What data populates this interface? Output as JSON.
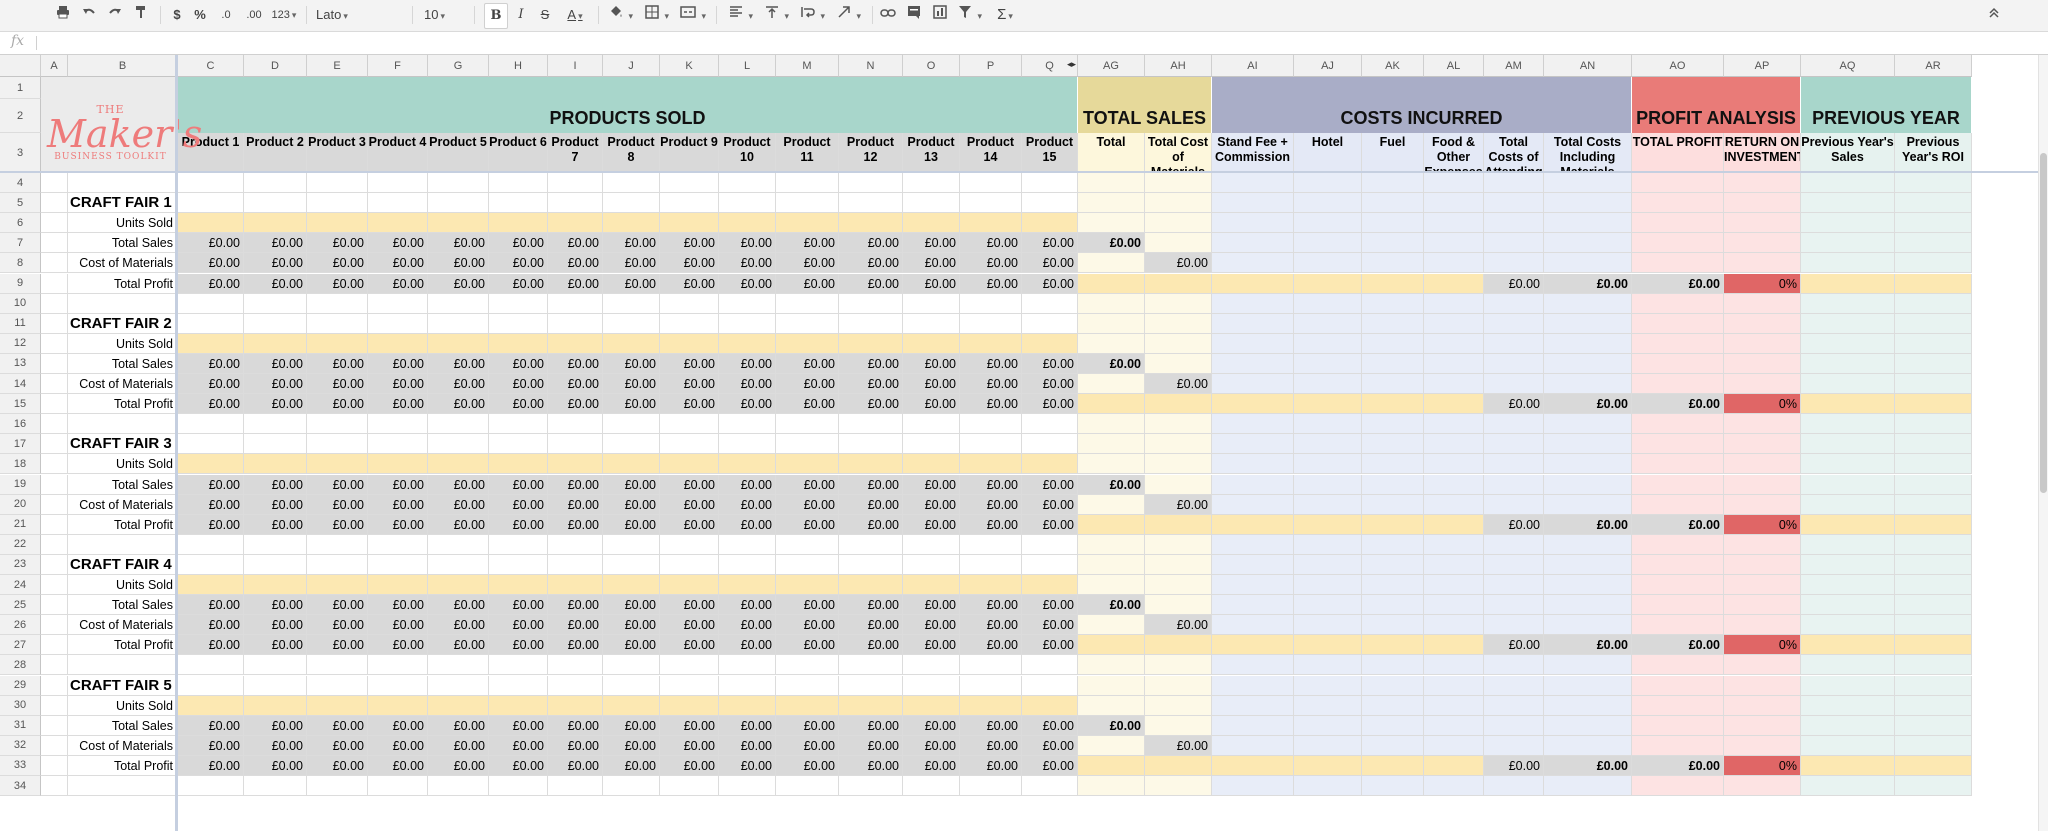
{
  "toolbar": {
    "currency": "$",
    "percent": "%",
    "dec_less": ".0",
    "dec_more": ".00",
    "format_more": "123",
    "font": "Lato",
    "font_size": "10",
    "bold": "B",
    "italic": "I",
    "strike": "S",
    "text_color": "A",
    "sum": "Σ"
  },
  "formula_bar": {
    "icon": "fx",
    "value": ""
  },
  "columns": [
    "A",
    "B",
    "C",
    "D",
    "E",
    "F",
    "G",
    "H",
    "I",
    "J",
    "K",
    "L",
    "M",
    "N",
    "O",
    "P",
    "Q",
    "AG",
    "AH",
    "AI",
    "AJ",
    "AK",
    "AL",
    "AM",
    "AN",
    "AO",
    "AP",
    "AQ",
    "AR"
  ],
  "rows": [
    "1",
    "2",
    "3",
    "4",
    "5",
    "6",
    "7",
    "8",
    "9",
    "10",
    "11",
    "12",
    "13",
    "14",
    "15",
    "16",
    "17",
    "18",
    "19",
    "20",
    "21",
    "22",
    "23",
    "24",
    "25",
    "26",
    "27",
    "28",
    "29",
    "30",
    "31",
    "32",
    "33",
    "34"
  ],
  "sections": [
    {
      "title": "PRODUCTS SOLD",
      "color": "#a8d6cb"
    },
    {
      "title": "TOTAL SALES",
      "color": "#e6d99a"
    },
    {
      "title": "COSTS INCURRED",
      "color": "#a9adc7"
    },
    {
      "title": "PROFIT ANALYSIS",
      "color": "#e97b78"
    },
    {
      "title": "PREVIOUS YEAR",
      "color": "#a8d6cb"
    }
  ],
  "headers": [
    "Product 1",
    "Product 2",
    "Product 3",
    "Product 4",
    "Product 5",
    "Product 6",
    "Product 7",
    "Product 8",
    "Product 9",
    "Product 10",
    "Product 11",
    "Product 12",
    "Product 13",
    "Product 14",
    "Product 15",
    "Total",
    "Total Cost of Materials",
    "Stand Fee + Commission",
    "Hotel",
    "Fuel",
    "Food & Other Expenses",
    "Total Costs of Attending Show",
    "Total Costs Including Materials",
    "TOTAL PROFIT",
    "RETURN ON INVESTMENT",
    "Previous Year's Sales",
    "Previous Year's ROI"
  ],
  "logo": {
    "line1": "THE",
    "line2": "Maker's",
    "line3": "BUSINESS TOOLKIT",
    "color": "#ee7b7b"
  },
  "row_labels": {
    "units": "Units Sold",
    "sales": "Total Sales",
    "materials": "Cost of Materials",
    "profit": "Total Profit"
  },
  "fairs": [
    "CRAFT FAIR 1",
    "CRAFT FAIR 2",
    "CRAFT FAIR 3",
    "CRAFT FAIR 4",
    "CRAFT FAIR 5"
  ],
  "values": {
    "money": "£0.00",
    "percent": "0%"
  }
}
